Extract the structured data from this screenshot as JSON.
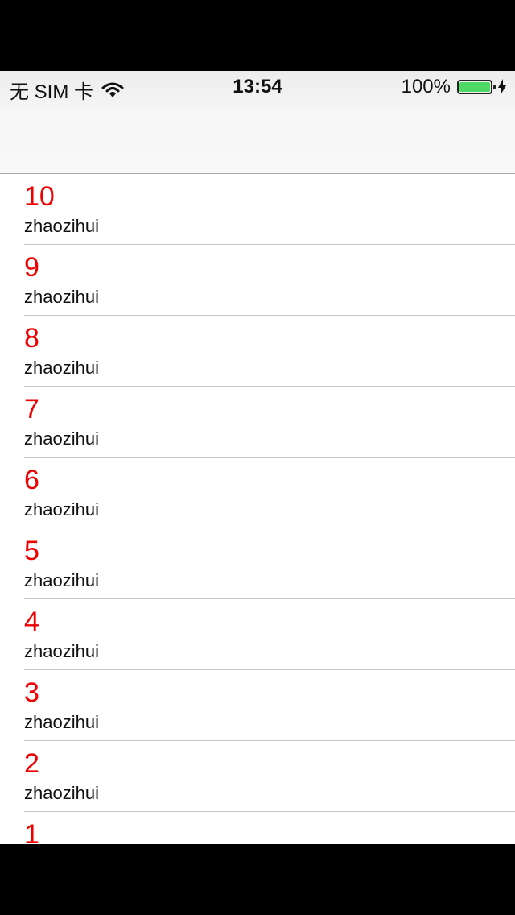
{
  "status_bar": {
    "carrier": "无 SIM 卡",
    "time": "13:54",
    "battery": "100%",
    "battery_color": "#4cd964"
  },
  "list": {
    "title_color": "#ee0000",
    "items": [
      {
        "title": "10",
        "subtitle": "zhaozihui"
      },
      {
        "title": "9",
        "subtitle": "zhaozihui"
      },
      {
        "title": "8",
        "subtitle": "zhaozihui"
      },
      {
        "title": "7",
        "subtitle": "zhaozihui"
      },
      {
        "title": "6",
        "subtitle": "zhaozihui"
      },
      {
        "title": "5",
        "subtitle": "zhaozihui"
      },
      {
        "title": "4",
        "subtitle": "zhaozihui"
      },
      {
        "title": "3",
        "subtitle": "zhaozihui"
      },
      {
        "title": "2",
        "subtitle": "zhaozihui"
      },
      {
        "title": "1",
        "subtitle": ""
      }
    ]
  }
}
